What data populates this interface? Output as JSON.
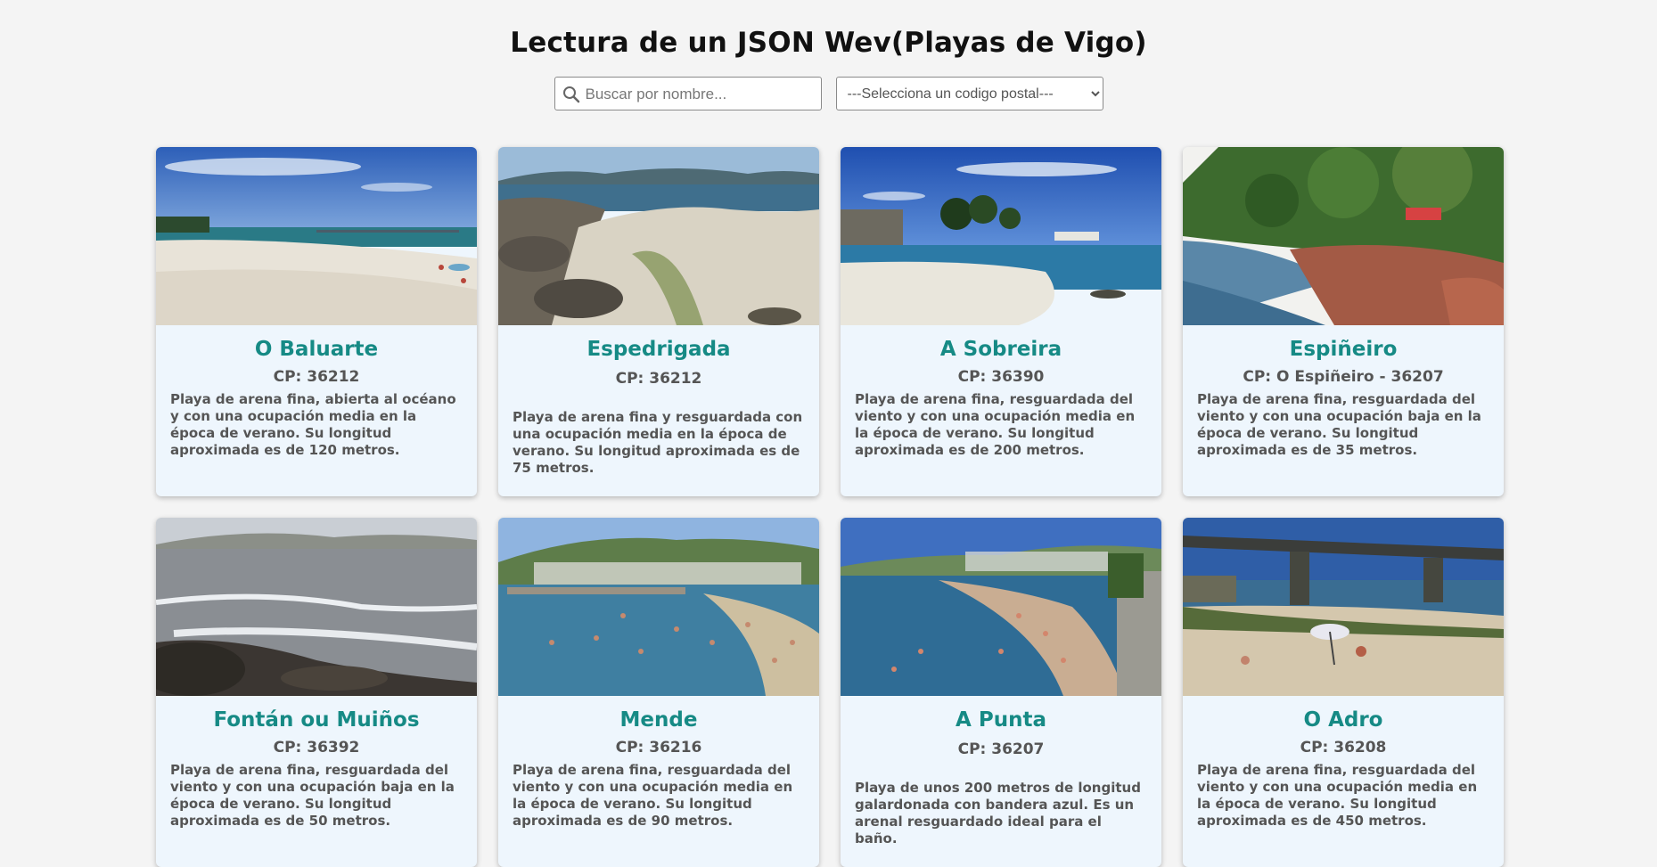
{
  "page": {
    "title": "Lectura de un JSON Wev(Playas de Vigo)"
  },
  "search": {
    "placeholder": "Buscar por nombre..."
  },
  "postal_select": {
    "selected": "---Selecciona un codigo postal---"
  },
  "beaches": [
    {
      "name": "O Baluarte",
      "cp": "CP: 36212",
      "description": "Playa de arena fina, abierta al océano y con una ocupación media en la época de verano. Su longitud aproximada es de 120 metros."
    },
    {
      "name": "Espedrigada",
      "cp": "CP: 36212",
      "description": "Playa de arena fina y resguardada con una ocupación media en la época de verano. Su longitud aproximada es de 75 metros."
    },
    {
      "name": "A Sobreira",
      "cp": "CP: 36390",
      "description": "Playa de arena fina, resguardada del viento y con una ocupación media en la época de verano. Su longitud aproximada es de 200 metros."
    },
    {
      "name": "Espiñeiro",
      "cp": "CP: O Espiñeiro - 36207",
      "description": "Playa de arena fina, resguardada del viento y con una ocupación baja en la época de verano. Su longitud aproximada es de 35 metros."
    },
    {
      "name": "Fontán ou Muiños",
      "cp": "CP: 36392",
      "description": "Playa de arena fina, resguardada del viento y con una ocupación baja en la época de verano. Su longitud aproximada es de 50 metros."
    },
    {
      "name": "Mende",
      "cp": "CP: 36216",
      "description": "Playa de arena fina, resguardada del viento y con una ocupación media en la época de verano. Su longitud aproximada es de 90 metros."
    },
    {
      "name": "A Punta",
      "cp": "CP: 36207",
      "description": "Playa de unos 200 metros de longitud galardonada con bandera azul. Es un arenal resguardado ideal para el baño."
    },
    {
      "name": "O Adro",
      "cp": "CP: 36208",
      "description": "Playa de arena fina, resguardada del viento y con una ocupación media en la época de verano. Su longitud aproximada es de 450 metros."
    }
  ],
  "colors": {
    "accent": "#168a85",
    "card_bg": "#eef6fd",
    "page_bg": "#f4f4f4"
  }
}
